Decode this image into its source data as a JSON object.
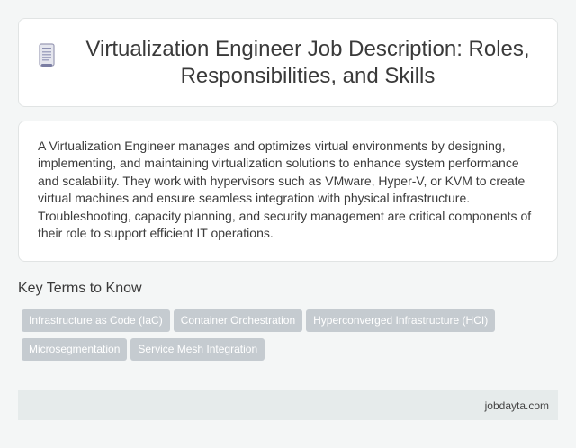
{
  "header": {
    "title": "Virtualization Engineer Job Description: Roles, Responsibilities, and Skills",
    "icon": "document-icon"
  },
  "description": {
    "text": "A Virtualization Engineer manages and optimizes virtual environments by designing, implementing, and maintaining virtualization solutions to enhance system performance and scalability. They work with hypervisors such as VMware, Hyper-V, or KVM to create virtual machines and ensure seamless integration with physical infrastructure. Troubleshooting, capacity planning, and security management are critical components of their role to support efficient IT operations."
  },
  "key_terms": {
    "heading": "Key Terms to Know",
    "items": [
      "Infrastructure as Code (IaC)",
      "Container Orchestration",
      "Hyperconverged Infrastructure (HCI)",
      "Microsegmentation",
      "Service Mesh Integration"
    ]
  },
  "footer": {
    "site": "jobdayta.com"
  },
  "colors": {
    "tag_bg": "#c5cbd0",
    "footer_bg": "#e6ebeb",
    "page_bg": "#f4f6f6"
  }
}
